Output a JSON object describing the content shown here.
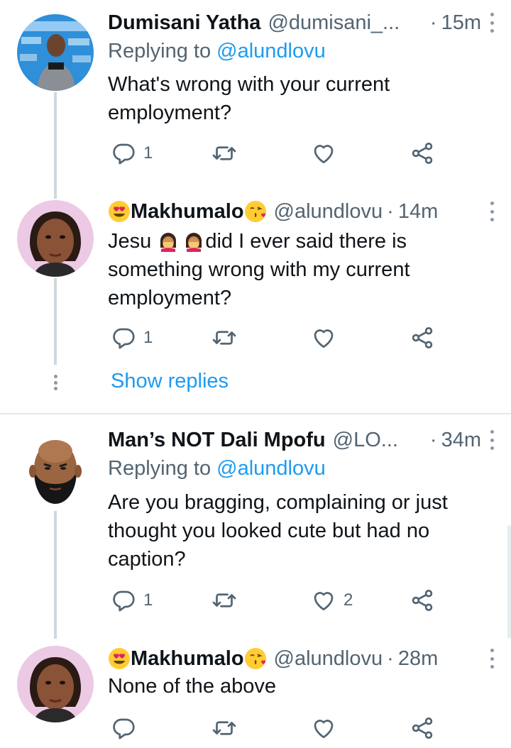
{
  "tweets": [
    {
      "name": "Dumisani Yatha",
      "handle": "@dumisani_...",
      "time": "15m",
      "replying_prefix": "Replying to ",
      "replying_to": "@alundlovu",
      "text": "What's wrong with your current employment?",
      "reply_count": "1",
      "like_count": ""
    },
    {
      "name": "Makhumalo",
      "handle": "@alundlovu",
      "time": "14m",
      "text_before": "Jesu ",
      "text_after": "did I ever said there is something wrong with my current employment?",
      "reply_count": "1",
      "like_count": ""
    },
    {
      "name": "Man’s NOT Dali Mpofu",
      "handle": "@LO...",
      "time": "34m",
      "replying_prefix": "Replying to ",
      "replying_to": "@alundlovu",
      "text": "Are you bragging, complaining or just thought you looked cute but had no caption?",
      "reply_count": "1",
      "like_count": "2"
    },
    {
      "name": "Makhumalo",
      "handle": "@alundlovu",
      "time": "28m",
      "text": "None of the above",
      "reply_count": "",
      "like_count": ""
    }
  ],
  "show_replies": "Show replies",
  "separator": "·",
  "icons": {
    "reply": "reply-icon",
    "retweet": "retweet-icon",
    "like": "heart-icon",
    "share": "share-icon",
    "more": "more-icon"
  },
  "colors": {
    "accent": "#1d9bf0",
    "secondary_text": "#536471",
    "thread_line": "#cfd9de"
  }
}
